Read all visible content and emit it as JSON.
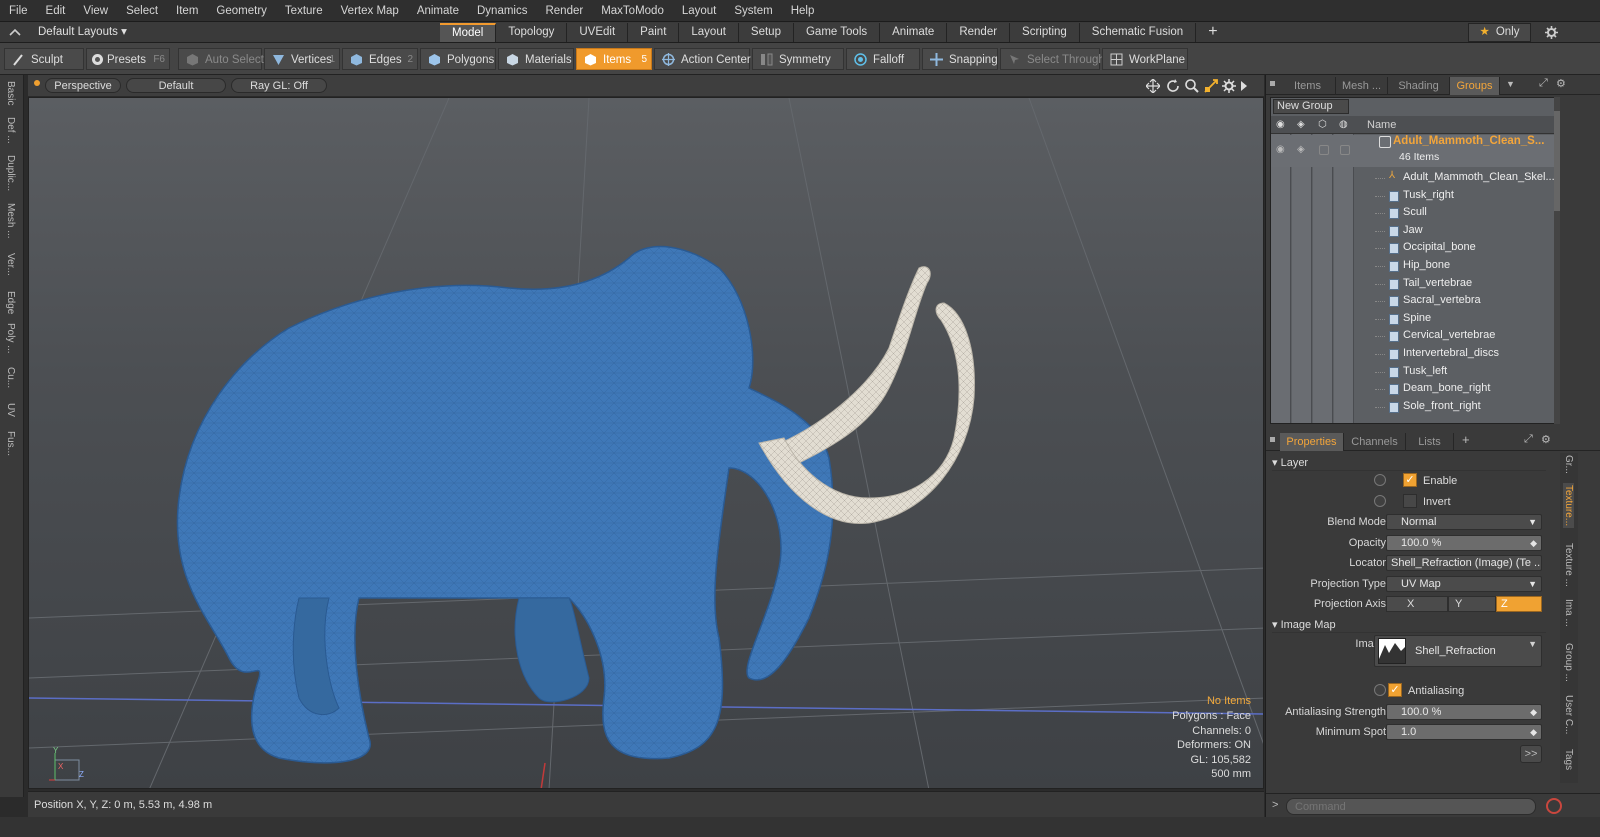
{
  "menu": [
    "File",
    "Edit",
    "View",
    "Select",
    "Item",
    "Geometry",
    "Texture",
    "Vertex Map",
    "Animate",
    "Dynamics",
    "Render",
    "MaxToModo",
    "Layout",
    "System",
    "Help"
  ],
  "layout_label": "Default Layouts",
  "layout_tabs": [
    "Model",
    "Topology",
    "UVEdit",
    "Paint",
    "Layout",
    "Setup",
    "Game Tools",
    "Animate",
    "Render",
    "Scripting",
    "Schematic Fusion"
  ],
  "active_tab": "Model",
  "only_label": "Only",
  "toolbar": {
    "sculpt": "Sculpt",
    "presets": "Presets",
    "presets_key": "F6",
    "auto_select": "Auto Select",
    "vertices": "Vertices",
    "vertices_key": "1",
    "edges": "Edges",
    "edges_key": "2",
    "polygons": "Polygons",
    "polygons_key": "3",
    "materials": "Materials",
    "items": "Items",
    "items_key": "5",
    "action_center": "Action Center",
    "symmetry": "Symmetry",
    "falloff": "Falloff",
    "snapping": "Snapping",
    "select_through": "Select Through",
    "workplane": "WorkPlane"
  },
  "left_rail": [
    "Basic",
    "Def ...",
    "Duplic...",
    "Mesh ...",
    "Ver...",
    "Edge",
    "Poly ...",
    "Cu...",
    "UV",
    "Fus..."
  ],
  "viewport": {
    "view": "Perspective",
    "shading": "Default",
    "raygl": "Ray GL: Off",
    "info": {
      "no_items": "No Items",
      "polygons": "Polygons : Face",
      "channels": "Channels: 0",
      "deformers": "Deformers: ON",
      "gl": "GL: 105,582",
      "scale": "500 mm"
    },
    "axis_x": "X",
    "axis_y": "Y",
    "axis_z": "Z"
  },
  "status": "Position X, Y, Z:   0 m, 5.53 m, 4.98 m",
  "groups_panel": {
    "tabs": [
      "Items",
      "Mesh ...",
      "Shading",
      "Groups"
    ],
    "active": "Groups",
    "new_group": "New Group",
    "name_header": "Name",
    "root": {
      "label": "Adult_Mammoth_Clean_S...",
      "count": "46 Items"
    },
    "items": [
      "Adult_Mammoth_Clean_Skel...",
      "Tusk_right",
      "Scull",
      "Jaw",
      "Occipital_bone",
      "Hip_bone",
      "Tail_vertebrae",
      "Sacral_vertebra",
      "Spine",
      "Cervical_vertebrae",
      "Intervertebral_discs",
      "Tusk_left",
      "Deam_bone_right",
      "Sole_front_right"
    ]
  },
  "props_panel": {
    "tabs": [
      "Properties",
      "Channels",
      "Lists"
    ],
    "active": "Properties",
    "layer_section": "Layer",
    "enable": "Enable",
    "invert": "Invert",
    "blend_mode_label": "Blend Mode",
    "blend_mode": "Normal",
    "opacity_label": "Opacity",
    "opacity": "100.0 %",
    "locator_label": "Locator",
    "locator": "Shell_Refraction (Image) (Te ...",
    "projection_type_label": "Projection Type",
    "projection_type": "UV Map",
    "projection_axis_label": "Projection Axis",
    "axes": [
      "X",
      "Y",
      "Z"
    ],
    "active_axis": "Z",
    "image_map_section": "Image Map",
    "image_label": "Image",
    "image": "Shell_Refraction",
    "antialiasing": "Antialiasing",
    "aa_strength_label": "Antialiasing Strength",
    "aa_strength": "100.0 %",
    "min_spot_label": "Minimum Spot",
    "min_spot": "1.0",
    "more": ">>"
  },
  "side_tabs": [
    "Gr...",
    "Texture...",
    "Texture ...",
    "Ima ...",
    "Group ...",
    "User C...",
    "Tags"
  ],
  "command_placeholder": "Command",
  "colors": {
    "accent": "#f09a2c",
    "mammoth": "#3f78b8",
    "tusk": "#e2ddd2"
  }
}
